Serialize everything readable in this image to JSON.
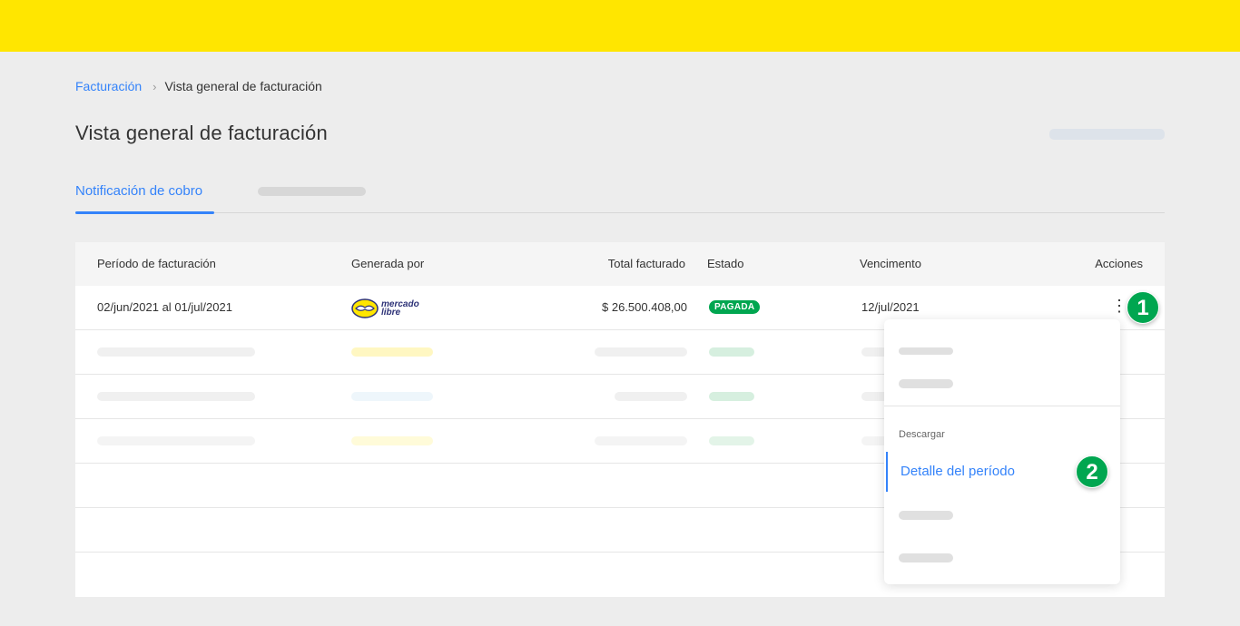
{
  "breadcrumb": {
    "parent": "Facturación",
    "current": "Vista general de facturación"
  },
  "page": {
    "title": "Vista general de facturación"
  },
  "tabs": [
    {
      "label": "Notificación de cobro",
      "active": true
    }
  ],
  "table": {
    "headers": [
      "Período de facturación",
      "Generada por",
      "Total facturado",
      "Estado",
      "Vencimento",
      "Acciones"
    ],
    "row": {
      "period_from": "02/jun/2021",
      "period_join": "al",
      "period_to": "01/jul/2021",
      "generated_by": "mercado libre",
      "logo_line1": "mercado",
      "logo_line2": "libre",
      "total": "$ 26.500.408,00",
      "status": "PAGADA",
      "due": "12/jul/2021",
      "actions_icon": "⋮"
    }
  },
  "menu": {
    "section": "Descargar",
    "active_item": "Detalle del período"
  },
  "steps": [
    "1",
    "2"
  ],
  "colors": {
    "brand_yellow": "#ffe600",
    "accent_blue": "#3483fa",
    "status_green": "#00a650"
  }
}
